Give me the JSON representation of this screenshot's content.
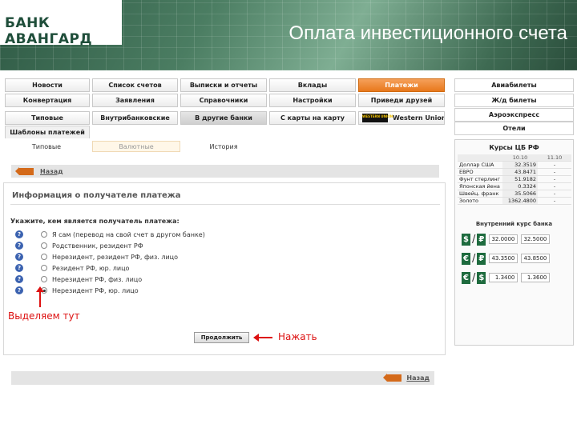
{
  "header": {
    "logo": "БАНК АВАНГАРД",
    "slide_title": "Оплата инвестиционного счета"
  },
  "nav": {
    "row1": [
      "Новости",
      "Список счетов",
      "Выписки и отчеты",
      "Вклады",
      "Платежи"
    ],
    "row2": [
      "Конвертация",
      "Заявления",
      "Справочники",
      "Настройки",
      "Приведи друзей"
    ],
    "row3": [
      "Типовые",
      "Внутрибанковские",
      "В другие банки",
      "С карты на карту",
      "Western Union"
    ],
    "wu_logo": "WESTERN UNION",
    "templates_tab": "Шаблоны платежей",
    "subtabs": [
      "Типовые",
      "Валютные",
      "История"
    ]
  },
  "right": {
    "buttons": [
      "Авиабилеты",
      "Ж/д билеты",
      "Аэроэкспресс",
      "Отели"
    ],
    "rates_title": "Курсы ЦБ РФ",
    "rates_header": [
      "",
      "10.10",
      "11.10"
    ],
    "rates_rows": [
      {
        "name": "Доллар США",
        "v1": "32.3519",
        "v2": "-"
      },
      {
        "name": "ЕВРО",
        "v1": "43.8471",
        "v2": "-"
      },
      {
        "name": "Фунт стерлинг",
        "v1": "51.9182",
        "v2": "-"
      },
      {
        "name": "Японская йена",
        "v1": "0.3324",
        "v2": "-"
      },
      {
        "name": "Швейц. франк",
        "v1": "35.5066",
        "v2": "-"
      },
      {
        "name": "Золото",
        "v1": "1362.4800",
        "v2": "-"
      }
    ],
    "internal_title": "Внутренний курс банка",
    "conversions": [
      {
        "from": "$",
        "to": "₽",
        "buy": "32.0000",
        "sell": "32.5000"
      },
      {
        "from": "€",
        "to": "₽",
        "buy": "43.3500",
        "sell": "43.8500"
      },
      {
        "from": "€",
        "to": "$",
        "buy": "1.3400",
        "sell": "1.3600"
      }
    ]
  },
  "main": {
    "back_label": "Назад",
    "section_title": "Информация о получателе платежа",
    "question": "Укажите, кем является получатель платежа:",
    "help_glyph": "?",
    "options": [
      {
        "label": "Я сам (перевод на свой счет в другом банке)",
        "checked": false
      },
      {
        "label": "Родственник, резидент РФ",
        "checked": false
      },
      {
        "label": "Нерезидент, резидент РФ, физ. лицо",
        "checked": false
      },
      {
        "label": "Резидент РФ, юр. лицо",
        "checked": false
      },
      {
        "label": "Нерезидент РФ, физ. лицо",
        "checked": false
      },
      {
        "label": "Нерезидент РФ, юр. лицо",
        "checked": true
      }
    ],
    "continue_label": "Продолжить",
    "annotation_select": "Выделяем тут",
    "annotation_press": "Нажать",
    "bottom_back_label": "Назад"
  }
}
